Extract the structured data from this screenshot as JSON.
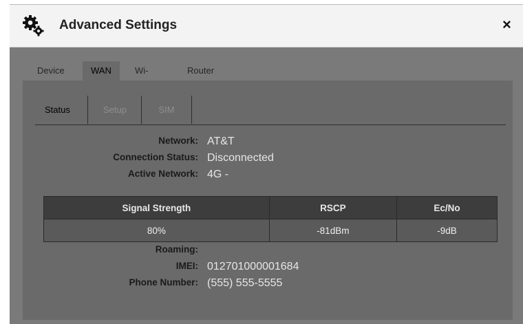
{
  "dialog": {
    "title": "Advanced Settings",
    "close_label": "×",
    "icon": "gears-icon"
  },
  "tabs": [
    {
      "label": "Device",
      "active": false
    },
    {
      "label": "WAN",
      "active": true
    },
    {
      "label": "Wi-Fi",
      "active": false
    },
    {
      "label": "Router",
      "active": false
    }
  ],
  "subtabs": [
    {
      "label": "Status",
      "active": true
    },
    {
      "label": "Setup",
      "active": false
    },
    {
      "label": "SIM",
      "active": false
    }
  ],
  "status": {
    "network_label": "Network:",
    "network_value": "AT&T",
    "connection_label": "Connection Status:",
    "connection_value": "Disconnected",
    "active_network_label": "Active Network:",
    "active_network_value": "4G -",
    "roaming_label": "Roaming:",
    "roaming_value": "",
    "imei_label": "IMEI:",
    "imei_value": "012701000001684",
    "phone_label": "Phone Number:",
    "phone_value": "(555) 555-5555"
  },
  "signal_table": {
    "headers": [
      "Signal Strength",
      "RSCP",
      "Ec/No"
    ],
    "row": [
      "80%",
      "-81dBm",
      "-9dB"
    ]
  },
  "colors": {
    "background": "#7a7a7a",
    "panel": "#6a6a6a",
    "header_row": "#3d3d3d",
    "titlebar": "#f3f3f3"
  }
}
